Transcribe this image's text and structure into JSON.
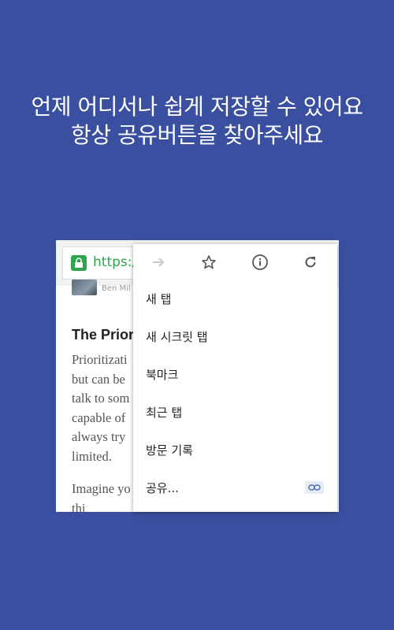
{
  "promo": {
    "headline_line1": "언제 어디서나 쉽게 저장할 수 있어요",
    "headline_line2": "항상 공유버튼을 찾아주세요"
  },
  "browser": {
    "url_text": "https:/",
    "author_text": "Ben Mil",
    "article_title": "The Prior",
    "article_lines": [
      "Prioritizati",
      "but can be",
      "talk to som",
      "capable of",
      "always try",
      "limited."
    ],
    "article_lines_2": [
      "Imagine yo",
      "thi"
    ]
  },
  "menu": {
    "icons": [
      "forward-icon",
      "star-icon",
      "info-icon",
      "reload-icon"
    ],
    "items": [
      {
        "label": "새 탭"
      },
      {
        "label": "새 시크릿 탭"
      },
      {
        "label": "북마크"
      },
      {
        "label": "최근 탭"
      },
      {
        "label": "방문 기록"
      },
      {
        "label": "공유..."
      }
    ]
  },
  "colors": {
    "background": "#3a4f9f",
    "secure_green": "#2ea44f"
  }
}
